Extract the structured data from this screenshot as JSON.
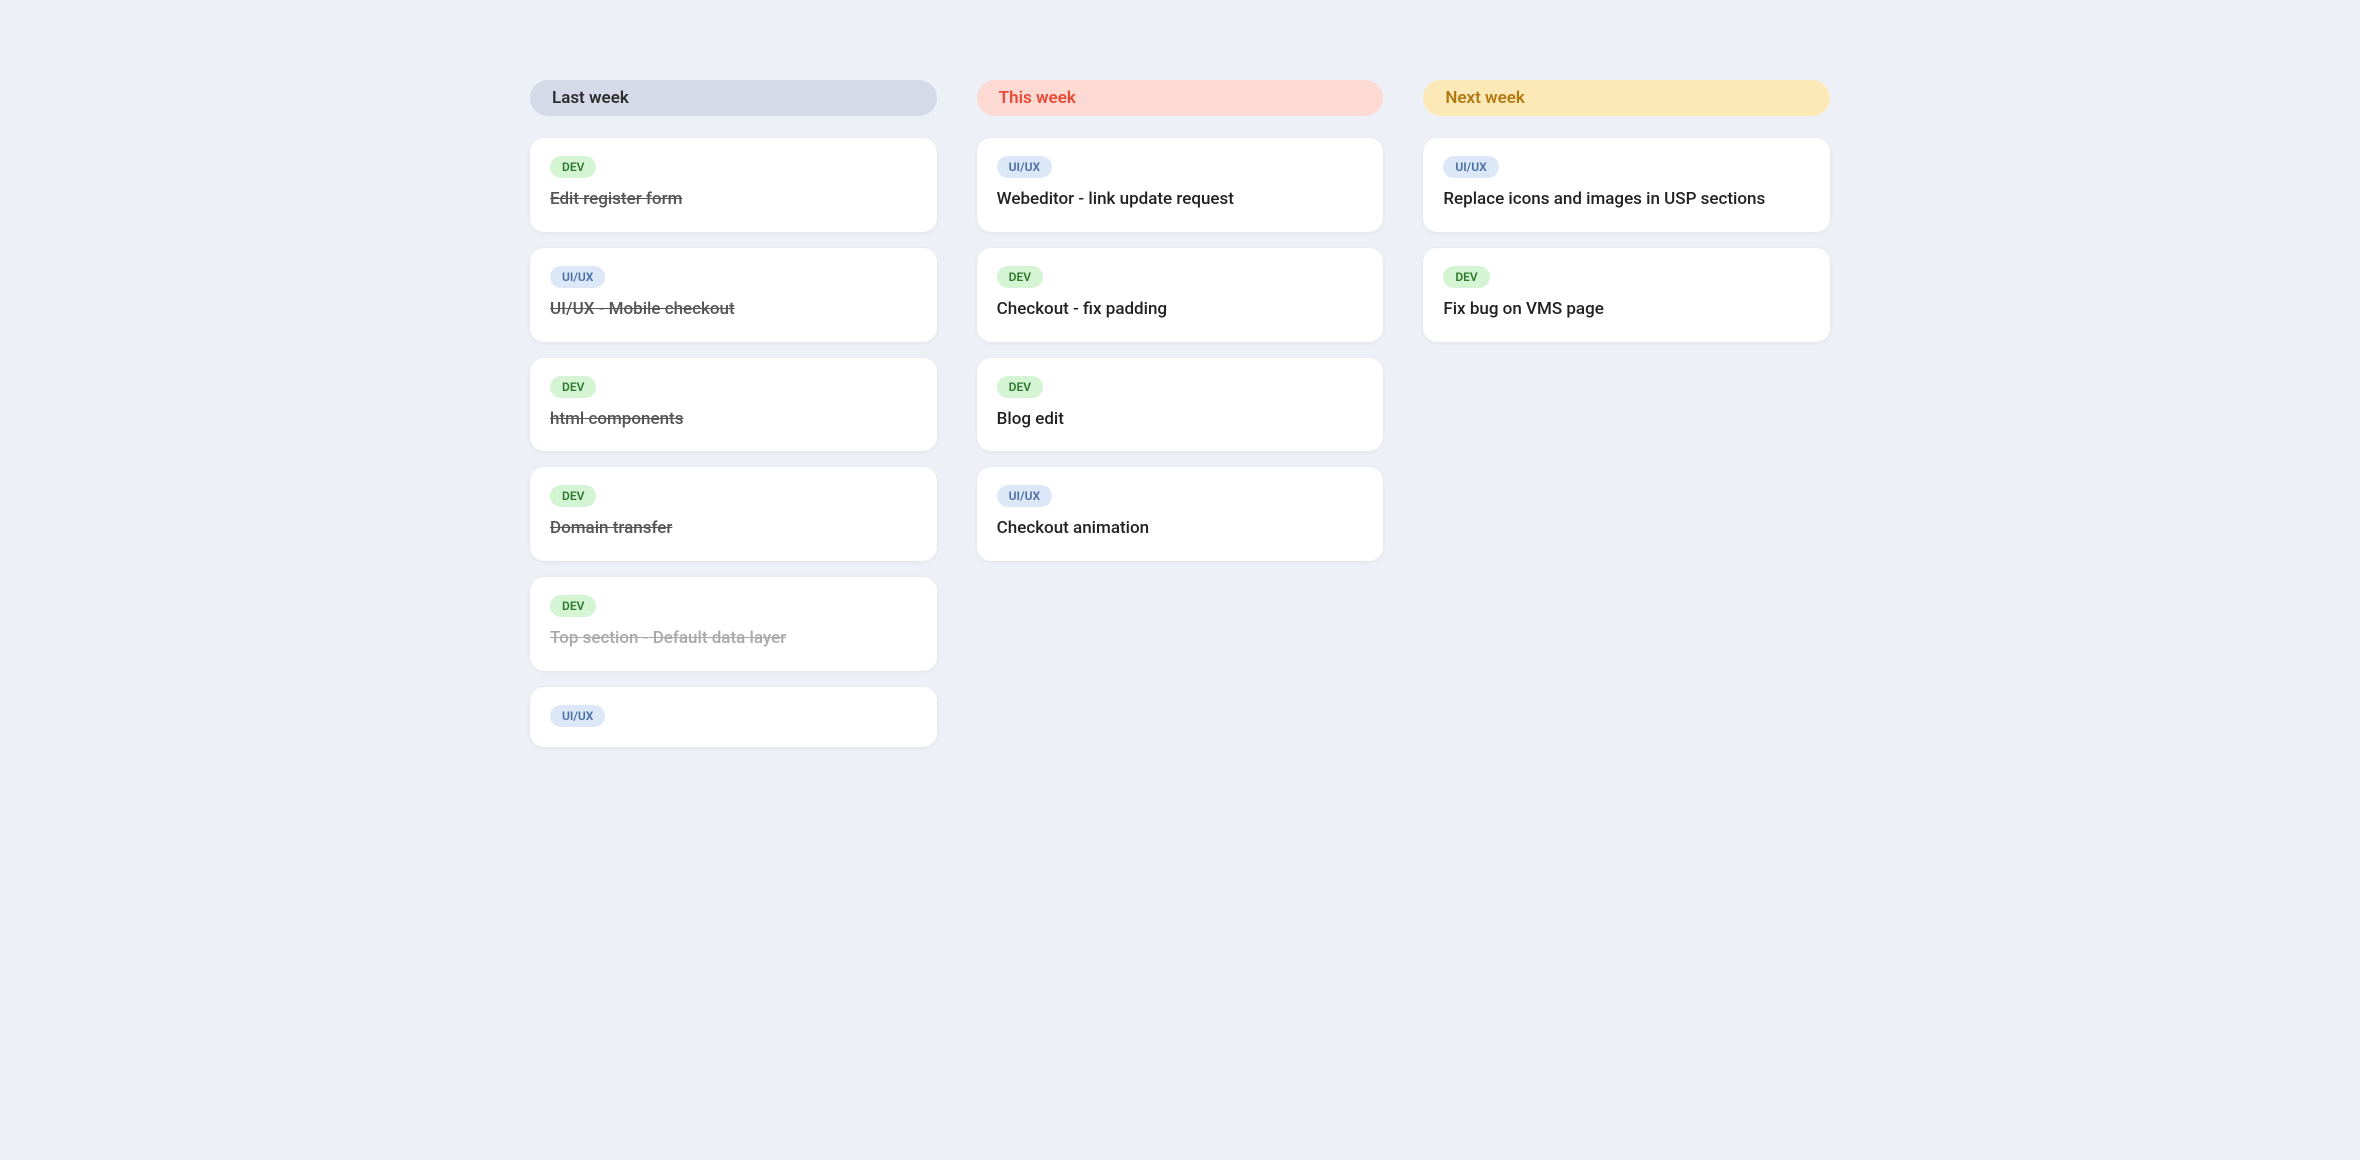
{
  "columns": [
    {
      "id": "last-week",
      "header": {
        "label": "Last week",
        "style": "last-week"
      },
      "cards": [
        {
          "tag": "DEV",
          "tag_type": "dev",
          "title": "Edit register form",
          "strikethrough": true,
          "light": false
        },
        {
          "tag": "UI/UX",
          "tag_type": "uiux",
          "title": "UI/UX - Mobile checkout",
          "strikethrough": true,
          "light": false
        },
        {
          "tag": "DEV",
          "tag_type": "dev",
          "title": "html components",
          "strikethrough": true,
          "light": false
        },
        {
          "tag": "DEV",
          "tag_type": "dev",
          "title": "Domain transfer",
          "strikethrough": true,
          "light": false
        },
        {
          "tag": "DEV",
          "tag_type": "dev",
          "title": "Top section - Default data layer",
          "strikethrough": true,
          "light": true
        },
        {
          "tag": "UI/UX",
          "tag_type": "uiux",
          "title": "",
          "strikethrough": false,
          "light": false,
          "tag_only": true
        }
      ]
    },
    {
      "id": "this-week",
      "header": {
        "label": "This week",
        "style": "this-week"
      },
      "cards": [
        {
          "tag": "UI/UX",
          "tag_type": "uiux",
          "title": "Webeditor - link update request",
          "strikethrough": false,
          "light": false
        },
        {
          "tag": "DEV",
          "tag_type": "dev",
          "title": "Checkout - fix padding",
          "strikethrough": false,
          "light": false
        },
        {
          "tag": "DEV",
          "tag_type": "dev",
          "title": "Blog edit",
          "strikethrough": false,
          "light": false
        },
        {
          "tag": "UI/UX",
          "tag_type": "uiux",
          "title": "Checkout animation",
          "strikethrough": false,
          "light": false
        }
      ]
    },
    {
      "id": "next-week",
      "header": {
        "label": "Next week",
        "style": "next-week"
      },
      "cards": [
        {
          "tag": "UI/UX",
          "tag_type": "uiux",
          "title": "Replace icons and images in USP sections",
          "strikethrough": false,
          "light": false
        },
        {
          "tag": "DEV",
          "tag_type": "dev",
          "title": "Fix bug on VMS page",
          "strikethrough": false,
          "light": false
        }
      ]
    }
  ]
}
